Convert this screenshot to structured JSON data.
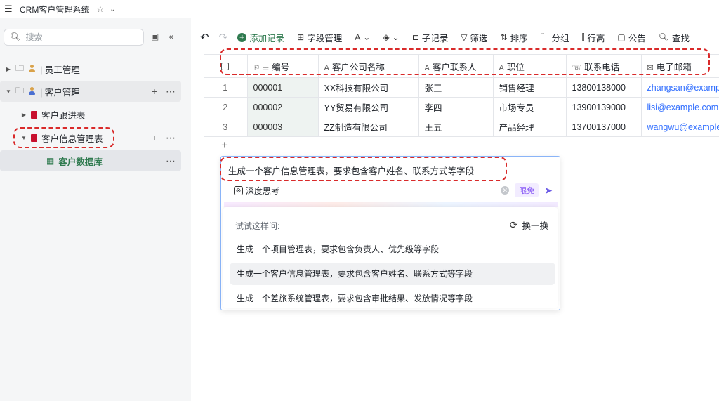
{
  "titlebar": {
    "title": "CRM客户管理系统",
    "star": "☆",
    "caret": "⌄"
  },
  "sidebar": {
    "search_placeholder": "搜索",
    "items": [
      {
        "label": "| 员工管理"
      },
      {
        "label": "| 客户管理"
      },
      {
        "label": "客户跟进表"
      },
      {
        "label": "客户信息管理表"
      },
      {
        "label": "客户数据库"
      }
    ]
  },
  "toolbar": {
    "add_record": "添加记录",
    "field_manage": "字段管理",
    "sub_record": "子记录",
    "filter": "筛选",
    "sort": "排序",
    "group": "分组",
    "row_height": "行高",
    "notice": "公告",
    "find": "查找"
  },
  "table": {
    "columns": [
      "编号",
      "客户公司名称",
      "客户联系人",
      "职位",
      "联系电话",
      "电子邮箱"
    ],
    "rows": [
      {
        "idx": "1",
        "code": "000001",
        "company": "XX科技有限公司",
        "contact": "张三",
        "position": "销售经理",
        "phone": "13800138000",
        "email": "zhangsan@example.com"
      },
      {
        "idx": "2",
        "code": "000002",
        "company": "YY贸易有限公司",
        "contact": "李四",
        "position": "市场专员",
        "phone": "13900139000",
        "email": "lisi@example.com"
      },
      {
        "idx": "3",
        "code": "000003",
        "company": "ZZ制造有限公司",
        "contact": "王五",
        "position": "产品经理",
        "phone": "13700137000",
        "email": "wangwu@example.com"
      }
    ],
    "add_row": "+"
  },
  "ai": {
    "input_text": "生成一个客户信息管理表，要求包含客户姓名、联系方式等字段",
    "deep_think": "深度思考",
    "limit_badge": "限免",
    "suggest_title": "试试这样问:",
    "refresh": "换一换",
    "suggestions": [
      "生成一个项目管理表，要求包含负责人、优先级等字段",
      "生成一个客户信息管理表，要求包含客户姓名、联系方式等字段",
      "生成一个差旅系统管理表，要求包含审批结果、发放情况等字段"
    ]
  },
  "colors": {
    "accent_green": "#2f7a4f",
    "highlight_red": "#d92a2a",
    "link_blue": "#3370ff",
    "ai_purple": "#8a5cf6"
  }
}
